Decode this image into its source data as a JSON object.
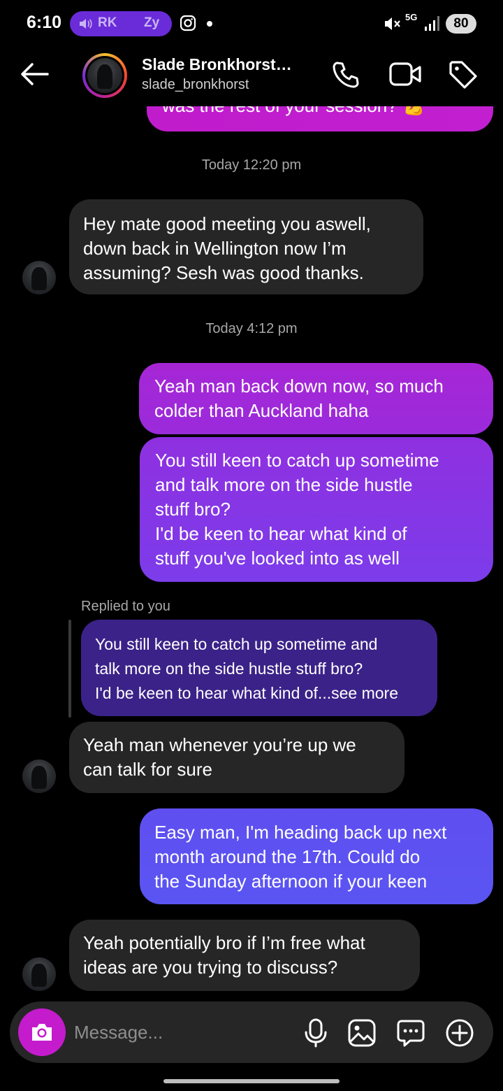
{
  "status_bar": {
    "time": "6:10",
    "pill_left": "RK",
    "pill_right": "Zy",
    "network": "5G",
    "battery": "80"
  },
  "header": {
    "name": "Slade Bronkhorst…",
    "username": "slade_bronkhorst"
  },
  "messages": {
    "top_sent_partial": "was the rest of your session? 💪",
    "timestamp_1": "Today 12:20 pm",
    "recv_1": [
      "Hey mate good meeting you aswell,",
      "down back in Wellington now I’m",
      "assuming? Sesh was good thanks."
    ],
    "timestamp_2": "Today 4:12 pm",
    "sent_1": [
      "Yeah man back down now, so much",
      "colder than Auckland haha"
    ],
    "sent_2": [
      "You still keen to catch up sometime",
      "and talk more on the side hustle",
      "stuff bro?",
      "I'd be keen to hear what kind of",
      "stuff you've looked into as well"
    ],
    "replied_label": "Replied to you",
    "quoted": [
      "You still keen to catch up sometime and",
      "talk more on the side hustle stuff bro?",
      "I'd be keen to hear what kind of...see more"
    ],
    "recv_2": [
      "Yeah man whenever you’re up we",
      "can talk for sure"
    ],
    "sent_3": [
      "Easy man, I'm heading back up next",
      "month around the 17th. Could do",
      "the Sunday afternoon if your keen"
    ],
    "recv_3": [
      "Yeah potentially bro if I’m free what",
      "ideas are you trying to discuss?"
    ]
  },
  "composer": {
    "placeholder": "Message..."
  },
  "colors": {
    "background": "#000000",
    "received_bubble": "#262626",
    "sent_gradient_top": "#c41bcc",
    "sent_gradient_bottom": "#5b53f0",
    "quoted_bubble": "#3b2288",
    "camera_button": "#c41bcc"
  },
  "icons": [
    "back-arrow-icon",
    "phone-icon",
    "video-camera-icon",
    "tag-icon",
    "camera-icon",
    "microphone-icon",
    "gallery-icon",
    "sticker-icon",
    "plus-icon",
    "instagram-icon",
    "mute-icon",
    "signal-icon",
    "speaker-icon"
  ]
}
